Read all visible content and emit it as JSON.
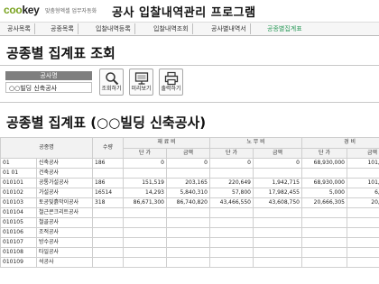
{
  "header": {
    "logo_main": "coo",
    "logo_accent": "key",
    "tagline": "맞춤형엑셀 업무자동화",
    "app_title": "공사 입찰내역관리 프로그램"
  },
  "nav": {
    "items": [
      {
        "label": "공사목록",
        "active": false
      },
      {
        "label": "공종목록",
        "active": false
      },
      {
        "label": "입찰내역등록",
        "active": false
      },
      {
        "label": "입찰내역조회",
        "active": false
      },
      {
        "label": "공사별내역서",
        "active": false
      },
      {
        "label": "공종별집계표",
        "active": true
      }
    ]
  },
  "section_title": "공종별 집계표 조회",
  "filter": {
    "project_label": "공사명",
    "project_value": "○○빌딩 신축공사"
  },
  "toolbar": {
    "search_label": "조회하기",
    "preview_label": "미리보기",
    "print_label": "출력하기"
  },
  "report_title": "공종별 집계표 (○○빌딩 신축공사)",
  "table": {
    "headers": {
      "name": "공종명",
      "qty": "수량",
      "material": "재 료 비",
      "labor": "노 무 비",
      "expense": "경 비",
      "unit_price": "단 가",
      "amount": "금액"
    },
    "rows": [
      {
        "code": "01",
        "name": "신축공사",
        "qty": "186",
        "mat_unit": "0",
        "mat_amt": "0",
        "lab_unit": "0",
        "lab_amt": "0",
        "exp_unit": "68,930,000",
        "exp_amt": "101,660,0"
      },
      {
        "code": "01 01",
        "name": "건축공사",
        "qty": "",
        "mat_unit": "",
        "mat_amt": "",
        "lab_unit": "",
        "lab_amt": "",
        "exp_unit": "",
        "exp_amt": ""
      },
      {
        "code": "010101",
        "name": "공통가설공사",
        "qty": "186",
        "mat_unit": "151,519",
        "mat_amt": "203,165",
        "lab_unit": "220,649",
        "lab_amt": "1,942,715",
        "exp_unit": "68,930,000",
        "exp_amt": "101,660,0"
      },
      {
        "code": "010102",
        "name": "가설공사",
        "qty": "16514",
        "mat_unit": "14,293",
        "mat_amt": "5,840,310",
        "lab_unit": "57,800",
        "lab_amt": "17,982,455",
        "exp_unit": "5,000",
        "exp_amt": "6,167,9"
      },
      {
        "code": "010103",
        "name": "토공및흙막이공사",
        "qty": "318",
        "mat_unit": "86,671,300",
        "mat_amt": "86,740,820",
        "lab_unit": "43,466,550",
        "lab_amt": "43,608,750",
        "exp_unit": "20,666,305",
        "exp_amt": "20,666,3"
      },
      {
        "code": "010104",
        "name": "철근콘크리트공사",
        "qty": "",
        "mat_unit": "",
        "mat_amt": "",
        "lab_unit": "",
        "lab_amt": "",
        "exp_unit": "",
        "exp_amt": ""
      },
      {
        "code": "010105",
        "name": "철골공사",
        "qty": "",
        "mat_unit": "",
        "mat_amt": "",
        "lab_unit": "",
        "lab_amt": "",
        "exp_unit": "",
        "exp_amt": ""
      },
      {
        "code": "010106",
        "name": "조적공사",
        "qty": "",
        "mat_unit": "",
        "mat_amt": "",
        "lab_unit": "",
        "lab_amt": "",
        "exp_unit": "",
        "exp_amt": ""
      },
      {
        "code": "010107",
        "name": "방수공사",
        "qty": "",
        "mat_unit": "",
        "mat_amt": "",
        "lab_unit": "",
        "lab_amt": "",
        "exp_unit": "",
        "exp_amt": ""
      },
      {
        "code": "010108",
        "name": "타일공사",
        "qty": "",
        "mat_unit": "",
        "mat_amt": "",
        "lab_unit": "",
        "lab_amt": "",
        "exp_unit": "",
        "exp_amt": ""
      },
      {
        "code": "010109",
        "name": "석공사",
        "qty": "",
        "mat_unit": "",
        "mat_amt": "",
        "lab_unit": "",
        "lab_amt": "",
        "exp_unit": "",
        "exp_amt": ""
      }
    ]
  },
  "colors": {
    "logo_green": "#7aa321",
    "active_nav": "#2d9b5b",
    "label_bg": "#7f7f7f"
  }
}
